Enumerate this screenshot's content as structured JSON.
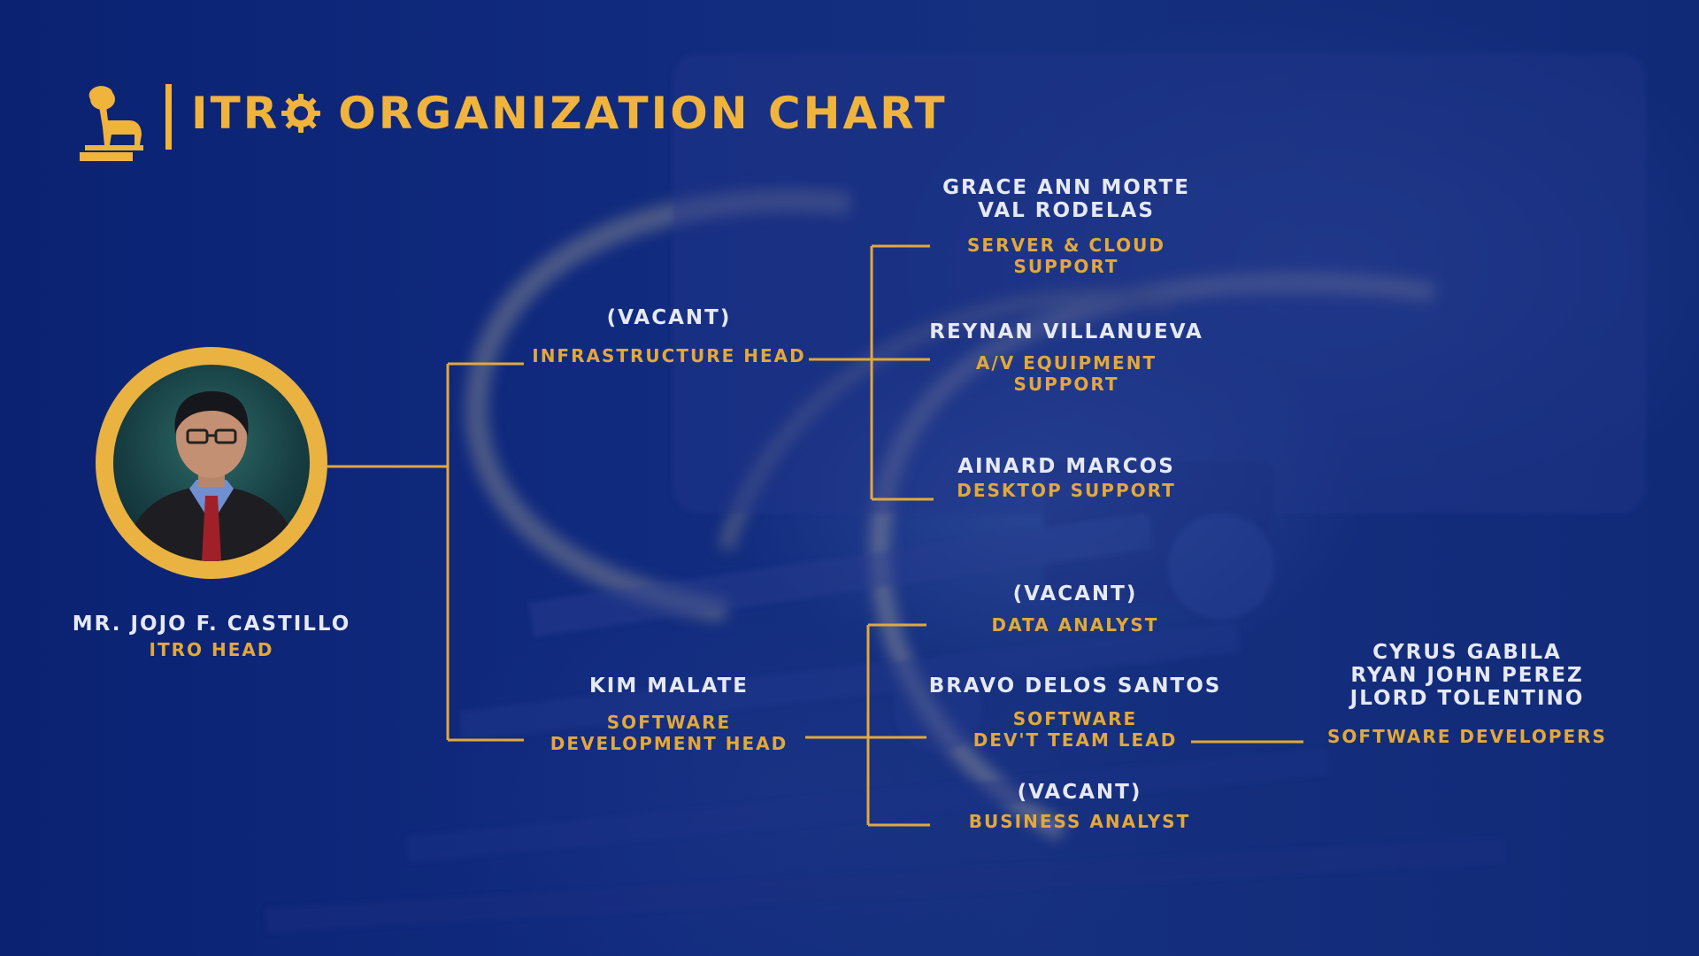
{
  "header": {
    "title_prefix": "ITR",
    "title_suffix": "ORGANIZATION CHART",
    "logo_icon": "ram-logo-icon",
    "gear_icon": "gear-icon"
  },
  "colors": {
    "background": "#102a7e",
    "accent": "#f0b43c",
    "role_text": "#e3a83a",
    "name_text": "#e6e9f3"
  },
  "head": {
    "name": "MR. JOJO F. CASTILLO",
    "role": "ITRO HEAD"
  },
  "infrastructure": {
    "head": {
      "name": "(VACANT)",
      "role": "INFRASTRUCTURE HEAD"
    },
    "members": [
      {
        "name_1": "GRACE ANN MORTE",
        "name_2": "VAL RODELAS",
        "role_1": "SERVER & CLOUD",
        "role_2": "SUPPORT"
      },
      {
        "name_1": "REYNAN VILLANUEVA",
        "role_1": "A/V EQUIPMENT",
        "role_2": "SUPPORT"
      },
      {
        "name_1": "AINARD MARCOS",
        "role_1": "DESKTOP SUPPORT"
      }
    ]
  },
  "software": {
    "head": {
      "name": "KIM MALATE",
      "role_1": "SOFTWARE",
      "role_2": "DEVELOPMENT HEAD"
    },
    "members": [
      {
        "name_1": "(VACANT)",
        "role_1": "DATA ANALYST"
      },
      {
        "name_1": "BRAVO DELOS SANTOS",
        "role_1": "SOFTWARE",
        "role_2": "DEV'T TEAM LEAD"
      },
      {
        "name_1": "(VACANT)",
        "role_1": "BUSINESS ANALYST"
      }
    ],
    "developers": {
      "names": [
        "CYRUS GABILA",
        "RYAN JOHN PEREZ",
        "JLORD TOLENTINO"
      ],
      "role": "SOFTWARE DEVELOPERS"
    }
  }
}
